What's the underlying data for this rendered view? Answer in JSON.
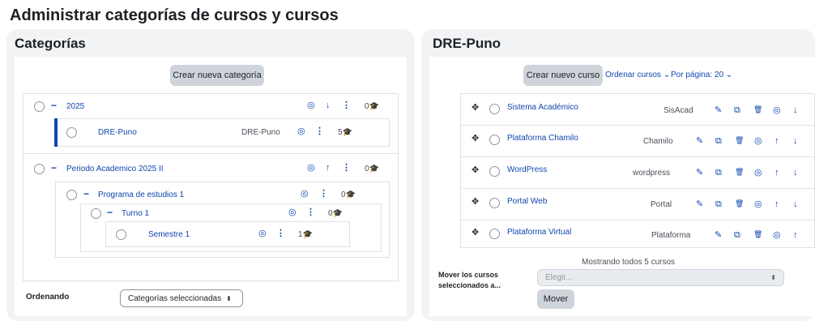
{
  "page": {
    "title": "Administrar categorías de cursos y cursos"
  },
  "left": {
    "title": "Categorías",
    "create_button": "Crear nueva categoría",
    "categories": [
      {
        "name": "2025",
        "count": "0"
      },
      {
        "name": "DRE-Puno",
        "idnumber": "DRE-Puno",
        "count": "5"
      },
      {
        "name": "Periodo Academico 2025 II",
        "count": "0"
      },
      {
        "name": "Programa de estudios 1",
        "count": "0"
      },
      {
        "name": "Turno 1",
        "count": "0"
      },
      {
        "name": "Semestre 1",
        "count": "1"
      }
    ],
    "sort_label": "Ordenando",
    "sort_select": "Categorías seleccionadas"
  },
  "right": {
    "title": "DRE-Puno",
    "create_button": "Crear nuevo curso",
    "sort_link": "Ordenar cursos",
    "perpage_link": "Por página: 20",
    "courses": [
      {
        "name": "Sistema Académico",
        "shortname": "SisAcad"
      },
      {
        "name": "Plataforma Chamilo",
        "shortname": "Chamilo"
      },
      {
        "name": "WordPress",
        "shortname": "wordpress"
      },
      {
        "name": "Portal Web",
        "shortname": "Portal"
      },
      {
        "name": "Plataforma Virtual",
        "shortname": "Plataforma"
      }
    ],
    "showing": "Mostrando todos 5 cursos",
    "move_label": "Mover los cursos seleccionados a...",
    "move_select": "Elegir...",
    "move_button": "Mover"
  },
  "icons": {
    "chevron": "⌄",
    "up": "↑",
    "down": "↓",
    "dots": "⋮",
    "eye": "◎",
    "move": "✥",
    "cap": "🎓",
    "edit": "✎",
    "copy": "⧉",
    "trash": "🗑"
  },
  "colors": {
    "link": "#0f47ad",
    "accent_bar": "#0f47ad",
    "panel": "#f2f3f5",
    "button": "#ced4da"
  }
}
